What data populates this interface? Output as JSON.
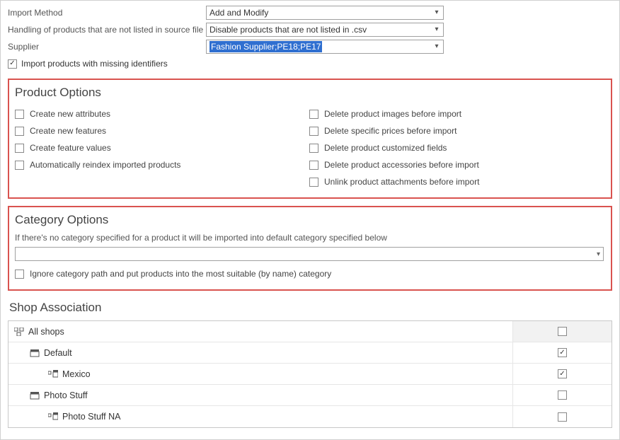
{
  "form": {
    "import_method_label": "Import Method",
    "import_method_value": "Add and Modify",
    "handling_label": "Handling of products that are not listed in source file",
    "handling_value": "Disable products that are not listed in .csv",
    "supplier_label": "Supplier",
    "supplier_value": "Fashion Supplier;PE18;PE17",
    "missing_ids_label": "Import products with missing identifiers"
  },
  "product_options": {
    "title": "Product Options",
    "left": [
      "Create new attributes",
      "Create new features",
      "Create feature values",
      "Automatically reindex imported products"
    ],
    "right": [
      "Delete product images before import",
      "Delete specific prices before import",
      "Delete product customized fields",
      "Delete product accessories before import",
      "Unlink product attachments before import"
    ]
  },
  "category_options": {
    "title": "Category Options",
    "note": "If there's no category specified for a product it will be imported into default category specified below",
    "ignore_label": "Ignore category path and put products into the most suitable (by name) category"
  },
  "shop": {
    "title": "Shop Association",
    "rows": [
      {
        "label": "All shops",
        "indent": 0,
        "icon": "root",
        "checked": false,
        "header": true
      },
      {
        "label": "Default",
        "indent": 1,
        "icon": "group",
        "checked": true
      },
      {
        "label": "Mexico",
        "indent": 2,
        "icon": "shop",
        "checked": true
      },
      {
        "label": "Photo Stuff",
        "indent": 1,
        "icon": "group",
        "checked": false
      },
      {
        "label": "Photo Stuff NA",
        "indent": 2,
        "icon": "shop",
        "checked": false
      }
    ]
  }
}
